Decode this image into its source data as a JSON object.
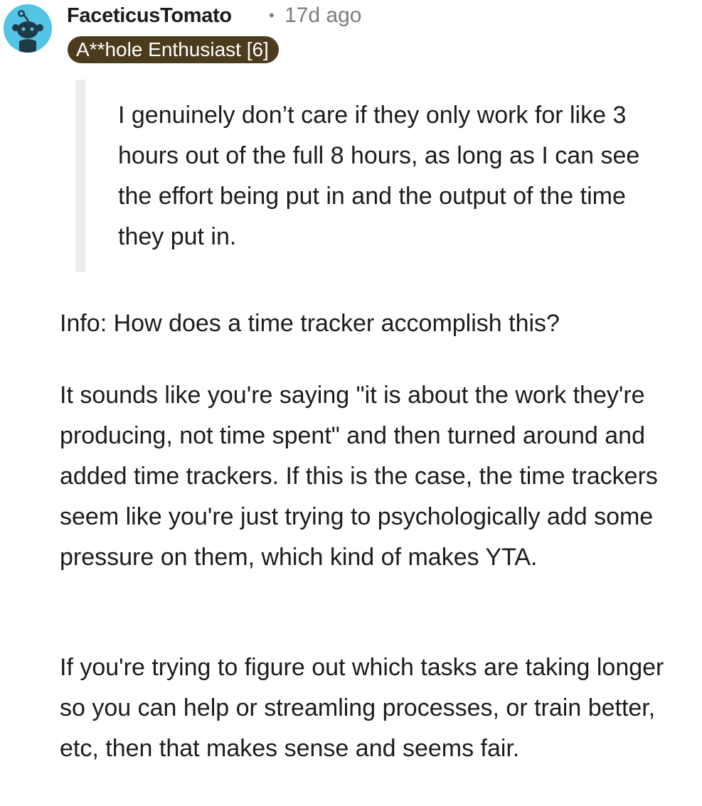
{
  "comment": {
    "author": "FaceticusTomato",
    "separator": "•",
    "timestamp": "17d ago",
    "flair": "A**hole Enthusiast [6]",
    "avatar_icon": "snoo-avatar-icon",
    "quote": "I genuinely don’t care if they only work for like 3 hours out of the full 8 hours, as long as I can see the effort being put in and the output of the time they put in.",
    "paragraphs": [
      "Info: How does a time tracker accomplish this?",
      "It sounds like you're saying \"it is about the work they're producing, not time spent\" and then turned around and added time trackers. If this is the case, the time trackers seem like you're just trying to psychologically add some pressure on them, which kind of makes YTA.",
      "If you're trying to figure out which tasks are taking longer so you can help or streamling processes, or train better, etc, then that makes sense and seems fair."
    ]
  },
  "colors": {
    "avatar_bg": "#54c4e4",
    "flair_bg": "#4d3b1d",
    "flair_text": "#ffffff",
    "meta_text": "#7c7c7c",
    "body_text": "#1c1c1c",
    "quote_bar": "#ececec"
  }
}
